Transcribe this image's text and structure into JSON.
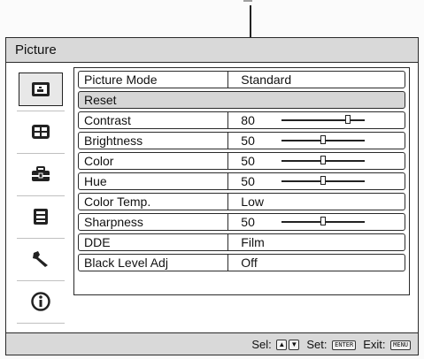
{
  "window": {
    "title": "Picture"
  },
  "sidebar": {
    "items": [
      {
        "icon": "picture-icon",
        "active": true
      },
      {
        "icon": "screen-icon",
        "active": false
      },
      {
        "icon": "toolbox-icon",
        "active": false
      },
      {
        "icon": "menu-list-icon",
        "active": false
      },
      {
        "icon": "wrench-icon",
        "active": false
      },
      {
        "icon": "info-icon",
        "active": false
      }
    ]
  },
  "settings": [
    {
      "label": "Picture Mode",
      "value": "Standard"
    },
    {
      "label": "Reset",
      "value": ""
    },
    {
      "label": "Contrast",
      "value": "80",
      "slider": 0.8
    },
    {
      "label": "Brightness",
      "value": "50",
      "slider": 0.5
    },
    {
      "label": "Color",
      "value": "50",
      "slider": 0.5
    },
    {
      "label": "Hue",
      "value": "50",
      "slider": 0.5
    },
    {
      "label": "Color Temp.",
      "value": "Low"
    },
    {
      "label": "Sharpness",
      "value": "50",
      "slider": 0.5
    },
    {
      "label": "DDE",
      "value": "Film"
    },
    {
      "label": "Black Level Adj",
      "value": "Off"
    }
  ],
  "status": {
    "sel_label": "Sel:",
    "set_label": "Set:",
    "set_key": "ENTER",
    "exit_label": "Exit:",
    "exit_key": "MENU"
  }
}
